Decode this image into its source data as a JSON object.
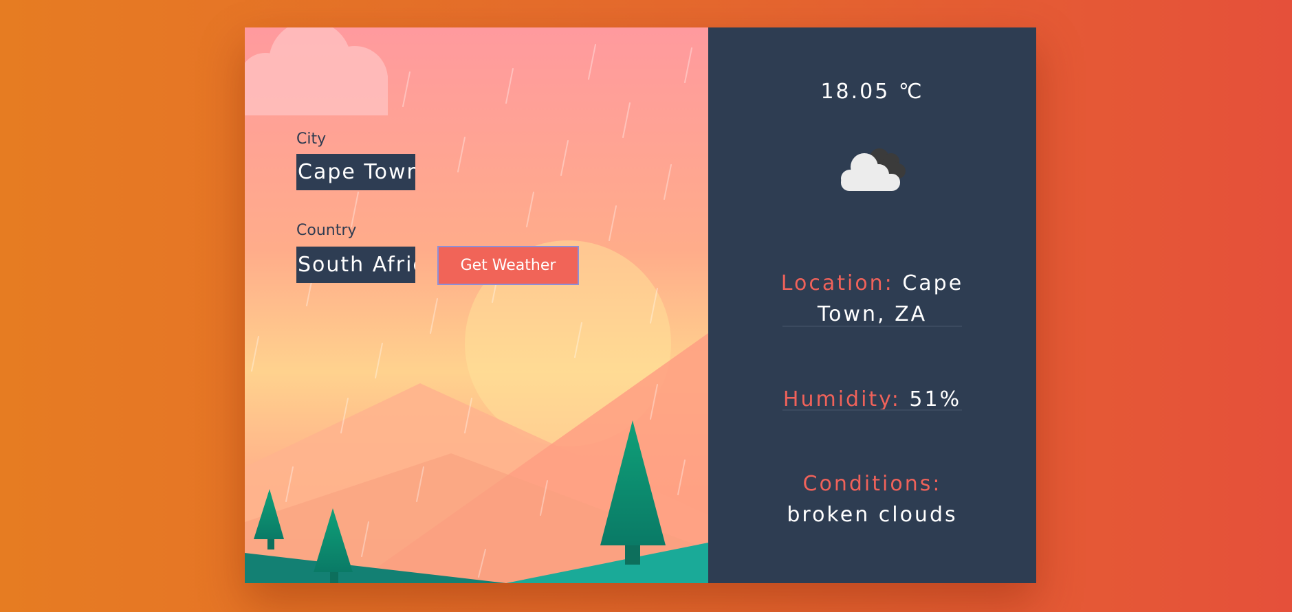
{
  "form": {
    "city_label": "City",
    "city_value": "Cape Town",
    "country_label": "Country",
    "country_value": "South Africa",
    "submit_label": "Get Weather"
  },
  "weather": {
    "temperature": "18.05 ℃",
    "icon": "broken-clouds-icon",
    "location_key": "Location:",
    "location_value": "Cape Town, ZA",
    "humidity_key": "Humidity:",
    "humidity_value": "51%",
    "conditions_key": "Conditions:",
    "conditions_value": "broken clouds"
  },
  "colors": {
    "accent": "#f16458",
    "panel": "#2e3d52",
    "background": "#e5682e"
  }
}
